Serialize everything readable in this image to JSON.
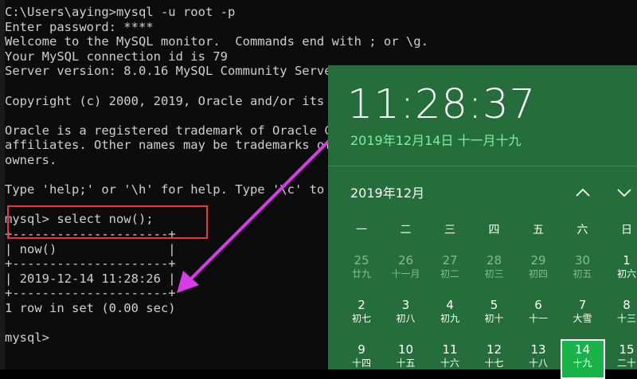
{
  "console": {
    "lines": [
      "C:\\Users\\aying>mysql -u root -p",
      "Enter password: ****",
      "Welcome to the MySQL monitor.  Commands end with ; or \\g.",
      "Your MySQL connection id is 79",
      "Server version: 8.0.16 MySQL Community Serve",
      "",
      "Copyright (c) 2000, 2019, Oracle and/or its",
      "",
      "Oracle is a registered trademark of Oracle C",
      "affiliates. Other names may be trademarks of",
      "owners.",
      "",
      "Type 'help;' or '\\h' for help. Type '\\c' to",
      "",
      "mysql> select now();",
      "+---------------------+",
      "| now()               |",
      "+---------------------+",
      "| 2019-12-14 11:28:26 |",
      "+---------------------+",
      "1 row in set (0.00 sec)",
      "",
      "mysql>"
    ]
  },
  "clock": {
    "time": "11:28:37",
    "date": "2019年12月14日 十一月十九"
  },
  "calendar": {
    "month_title": "2019年12月",
    "weekdays": [
      "一",
      "二",
      "三",
      "四",
      "五",
      "六",
      "日"
    ],
    "weeks": [
      [
        {
          "num": "25",
          "lunar": "廿九",
          "muted": true
        },
        {
          "num": "26",
          "lunar": "十一月",
          "muted": true
        },
        {
          "num": "27",
          "lunar": "初二",
          "muted": true
        },
        {
          "num": "28",
          "lunar": "初三",
          "muted": true
        },
        {
          "num": "29",
          "lunar": "初四",
          "muted": true
        },
        {
          "num": "30",
          "lunar": "初五",
          "muted": true
        },
        {
          "num": "1",
          "lunar": "初六",
          "muted": false
        }
      ],
      [
        {
          "num": "2",
          "lunar": "初七",
          "muted": false
        },
        {
          "num": "3",
          "lunar": "初八",
          "muted": false
        },
        {
          "num": "4",
          "lunar": "初九",
          "muted": false
        },
        {
          "num": "5",
          "lunar": "初十",
          "muted": false
        },
        {
          "num": "6",
          "lunar": "十一",
          "muted": false
        },
        {
          "num": "7",
          "lunar": "大雪",
          "muted": false
        },
        {
          "num": "8",
          "lunar": "十三",
          "muted": false
        }
      ],
      [
        {
          "num": "9",
          "lunar": "十四",
          "muted": false
        },
        {
          "num": "10",
          "lunar": "十五",
          "muted": false
        },
        {
          "num": "11",
          "lunar": "十六",
          "muted": false
        },
        {
          "num": "12",
          "lunar": "十七",
          "muted": false
        },
        {
          "num": "13",
          "lunar": "十八",
          "muted": false
        },
        {
          "num": "14",
          "lunar": "十九",
          "muted": false,
          "today": true
        },
        {
          "num": "15",
          "lunar": "二十",
          "muted": false
        }
      ]
    ]
  },
  "colors": {
    "console_bg": "#0c0c0c",
    "console_text": "#cfcfcf",
    "flyout_bg": "#256e3c",
    "date_accent": "#7ef0a0",
    "today_bg": "#19b34a",
    "highlight_red": "#e23b3b",
    "arrow_magenta": "#d83ce6"
  },
  "icons": {
    "nav_up": "chevron-up-icon",
    "nav_down": "chevron-down-icon"
  }
}
